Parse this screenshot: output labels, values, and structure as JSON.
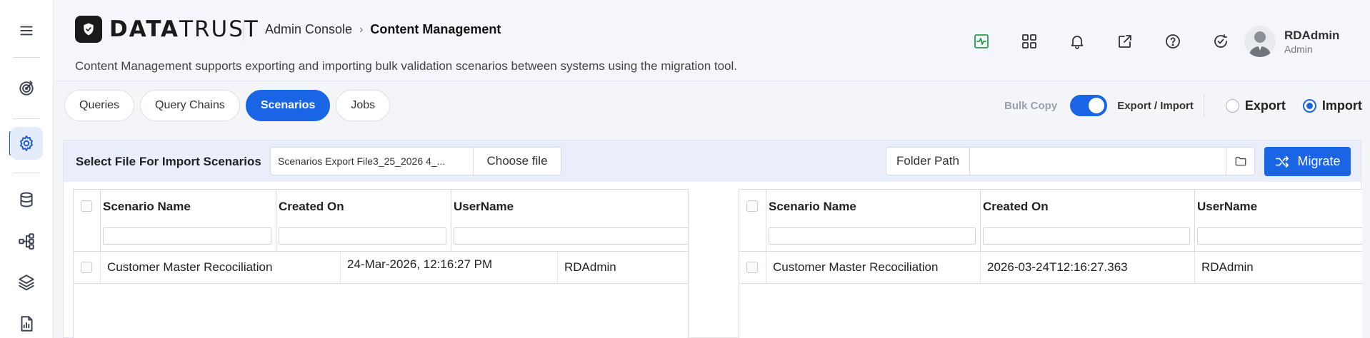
{
  "app": {
    "brand_prefix": "DATA",
    "brand_suffix": "TRUST",
    "breadcrumb": [
      "Admin Console",
      "Content Management"
    ],
    "breadcrumb_separator": "›",
    "description": "Content Management supports exporting and importing bulk validation scenarios between systems using the migration tool."
  },
  "sidebar": {
    "items": [
      {
        "icon": "menu-icon"
      },
      {
        "icon": "target-icon"
      },
      {
        "icon": "settings-icon",
        "active": true
      },
      {
        "icon": "database-icon"
      },
      {
        "icon": "hierarchy-icon"
      },
      {
        "icon": "layers-icon"
      },
      {
        "icon": "report-icon"
      }
    ]
  },
  "header_icons": [
    "activity-icon",
    "grid-icon",
    "bell-icon",
    "external-link-icon",
    "help-icon",
    "check-refresh-icon"
  ],
  "user": {
    "name": "RDAdmin",
    "role": "Admin"
  },
  "tabs": [
    {
      "label": "Queries",
      "active": false
    },
    {
      "label": "Query Chains",
      "active": false
    },
    {
      "label": "Scenarios",
      "active": true
    },
    {
      "label": "Jobs",
      "active": false
    }
  ],
  "mode": {
    "bulk_copy_label": "Bulk Copy",
    "export_import_label": "Export / Import",
    "toggle_on": true,
    "export_label": "Export",
    "import_label": "Import",
    "selected": "Import"
  },
  "import_bar": {
    "label": "Select File For Import Scenarios",
    "file_name": "Scenarios Export File3_25_2026 4_...",
    "choose_label": "Choose file",
    "folder_label": "Folder Path",
    "folder_value": "",
    "migrate_label": "Migrate"
  },
  "left_grid": {
    "columns": [
      "Scenario Name",
      "Created On",
      "UserName"
    ],
    "rows": [
      {
        "name": "Customer Master Recociliation",
        "created": "24-Mar-2026, 12:16:27 PM",
        "user": "RDAdmin"
      }
    ]
  },
  "right_grid": {
    "columns": [
      "Scenario Name",
      "Created On",
      "UserName"
    ],
    "rows": [
      {
        "name": "Customer Master Recociliation",
        "created": "2026-03-24T12:16:27.363",
        "user": "RDAdmin"
      }
    ]
  },
  "colors": {
    "accent": "#1a64e6",
    "active_bg": "#e4ebfb",
    "green": "#2e9b4b"
  }
}
